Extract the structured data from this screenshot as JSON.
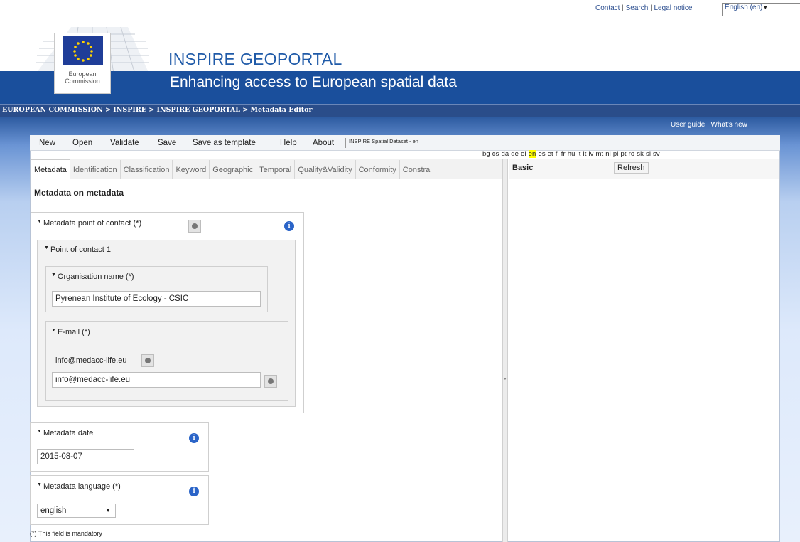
{
  "top_links": {
    "contact": "Contact",
    "search": "Search",
    "legal": "Legal notice",
    "sep": " | "
  },
  "language_selector": {
    "value": "English (en)"
  },
  "header": {
    "title": "INSPIRE GEOPORTAL",
    "subtitle": "Enhancing access to European spatial data",
    "logo_text_1": "European",
    "logo_text_2": "Commission"
  },
  "breadcrumb": "EUROPEAN COMMISSION > INSPIRE > INSPIRE GEOPORTAL > Metadata Editor",
  "user_links": {
    "guide": "User guide",
    "sep": " | ",
    "whats_new": "What's new"
  },
  "menu": {
    "new": "New",
    "open": "Open",
    "validate": "Validate",
    "save": "Save",
    "save_template": "Save as template",
    "help": "Help",
    "about": "About",
    "template_name": "INSPIRE Spatial Dataset - en"
  },
  "languages": [
    "bg",
    "cs",
    "da",
    "de",
    "el",
    "en",
    "es",
    "et",
    "fi",
    "fr",
    "hu",
    "it",
    "lt",
    "lv",
    "mt",
    "nl",
    "pl",
    "pt",
    "ro",
    "sk",
    "sl",
    "sv"
  ],
  "active_language": "en",
  "tabs": [
    "Metadata",
    "Identification",
    "Classification",
    "Keyword",
    "Geographic",
    "Temporal",
    "Quality&Validity",
    "Conformity",
    "Constra"
  ],
  "right_panel": {
    "basic": "Basic",
    "refresh": "Refresh"
  },
  "form": {
    "section_title": "Metadata on metadata",
    "contact_label": "Metadata point of contact (*)",
    "poc_label": "Point of contact 1",
    "org_label": "Organisation name (*)",
    "org_value": "Pyrenean Institute of Ecology - CSIC",
    "email_label": "E-mail (*)",
    "email_listed": "info@medacc-life.eu",
    "email_value": "info@medacc-life.eu",
    "date_label": "Metadata date",
    "date_value": "2015-08-07",
    "language_label": "Metadata language (*)",
    "language_value": "english",
    "mandatory_note": "(*) This field is mandatory"
  },
  "colors": {
    "banner": "#1a4f9c",
    "title": "#1f5aa8",
    "highlight": "#ffff00",
    "info": "#2a64c8"
  }
}
